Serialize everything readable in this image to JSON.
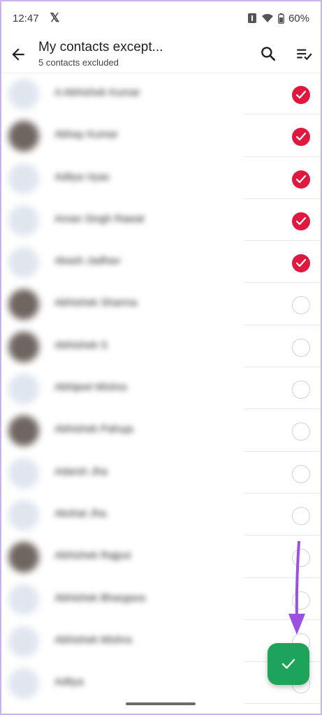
{
  "status_bar": {
    "time": "12:47",
    "battery": "60%"
  },
  "app_bar": {
    "title": "My contacts except...",
    "subtitle": "5 contacts excluded"
  },
  "contacts": [
    {
      "name": "A Abhishek Kumar",
      "selected": true,
      "avatar": "blank"
    },
    {
      "name": "Abhay Kumar",
      "selected": true,
      "avatar": "photo"
    },
    {
      "name": "Aditya Vyas",
      "selected": true,
      "avatar": "blank"
    },
    {
      "name": "Aman Singh Rawat",
      "selected": true,
      "avatar": "blank"
    },
    {
      "name": "Akash Jadhav",
      "selected": true,
      "avatar": "blank"
    },
    {
      "name": "Abhishek Sharma",
      "selected": false,
      "avatar": "photo"
    },
    {
      "name": "Abhishek S",
      "selected": false,
      "avatar": "photo"
    },
    {
      "name": "Abhijeet Mishra",
      "selected": false,
      "avatar": "blank"
    },
    {
      "name": "Abhishek Pahuja",
      "selected": false,
      "avatar": "photo"
    },
    {
      "name": "Adarsh Jha",
      "selected": false,
      "avatar": "blank"
    },
    {
      "name": "Akshat Jha",
      "selected": false,
      "avatar": "blank"
    },
    {
      "name": "Abhishek Rajput",
      "selected": false,
      "avatar": "photo"
    },
    {
      "name": "Abhishek Bhargava",
      "selected": false,
      "avatar": "blank"
    },
    {
      "name": "Abhishek Mishra",
      "selected": false,
      "avatar": "blank"
    },
    {
      "name": "Aditya",
      "selected": false,
      "avatar": "blank"
    }
  ],
  "colors": {
    "selected_check": "#e0173f",
    "fab": "#1ea35a",
    "arrow": "#9b51e0"
  },
  "icons": {
    "back": "arrow-left-icon",
    "search": "search-icon",
    "select_all": "checklist-icon",
    "confirm": "check-icon",
    "x_app": "x-logo-icon"
  }
}
